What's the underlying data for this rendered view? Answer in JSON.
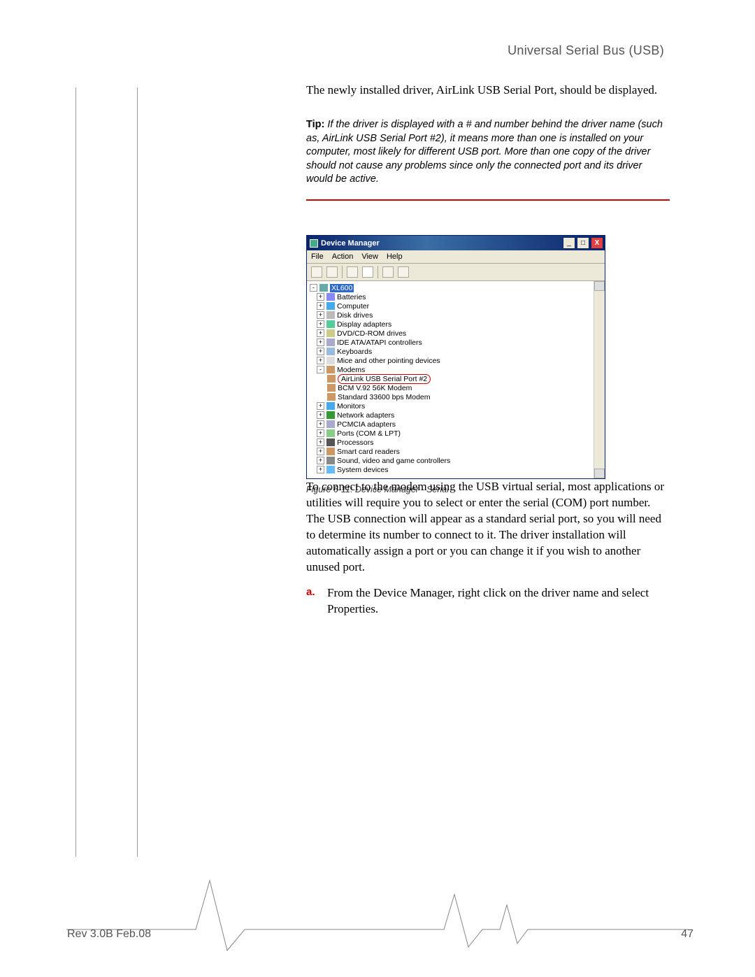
{
  "header": {
    "title": "Universal Serial Bus (USB)"
  },
  "body": {
    "p1": "The newly installed driver, AirLink USB Serial Port, should be displayed.",
    "tip_label": "Tip:",
    "tip_text": "If the driver is displayed with a # and number behind the driver name (such as, AirLink USB Serial Port #2), it means more than one is installed on your computer, most likely for different USB port. More than one copy of the driver should not cause any problems since only the connected port and its driver would be active.",
    "caption": "Figure 6-11: Device Manager - Serial",
    "p2": "To connect to the modem using the USB virtual serial, most applications or utilities will require you to select or enter the serial (COM) port number. The USB connection will appear as a standard serial port, so you will need to determine its number to connect to it. The driver installation will automatically assign a port or you can change it if you wish to another unused port.",
    "step_letter": "a.",
    "step_text": "From the Device Manager, right click on the driver name and select Properties."
  },
  "device_manager": {
    "title": "Device Manager",
    "menu": [
      "File",
      "Action",
      "View",
      "Help"
    ],
    "root": "XL600",
    "nodes": [
      {
        "label": "Batteries",
        "exp": "+",
        "icon": "i-bat"
      },
      {
        "label": "Computer",
        "exp": "+",
        "icon": "i-mon"
      },
      {
        "label": "Disk drives",
        "exp": "+",
        "icon": "i-disk"
      },
      {
        "label": "Display adapters",
        "exp": "+",
        "icon": "i-disp"
      },
      {
        "label": "DVD/CD-ROM drives",
        "exp": "+",
        "icon": "i-dvd"
      },
      {
        "label": "IDE ATA/ATAPI controllers",
        "exp": "+",
        "icon": "i-ide"
      },
      {
        "label": "Keyboards",
        "exp": "+",
        "icon": "i-kb"
      },
      {
        "label": "Mice and other pointing devices",
        "exp": "+",
        "icon": "i-mouse"
      },
      {
        "label": "Modems",
        "exp": "-",
        "icon": "i-modem"
      },
      {
        "label": "Monitors",
        "exp": "+",
        "icon": "i-mon"
      },
      {
        "label": "Network adapters",
        "exp": "+",
        "icon": "i-net"
      },
      {
        "label": "PCMCIA adapters",
        "exp": "+",
        "icon": "i-pcm"
      },
      {
        "label": "Ports (COM & LPT)",
        "exp": "+",
        "icon": "i-port"
      },
      {
        "label": "Processors",
        "exp": "+",
        "icon": "i-proc"
      },
      {
        "label": "Smart card readers",
        "exp": "+",
        "icon": "i-smart"
      },
      {
        "label": "Sound, video and game controllers",
        "exp": "+",
        "icon": "i-snd"
      },
      {
        "label": "System devices",
        "exp": "+",
        "icon": "i-sys"
      }
    ],
    "modem_children": [
      "AirLink USB Serial Port #2",
      "BCM V.92 56K Modem",
      "Standard 33600 bps Modem"
    ]
  },
  "footer": {
    "rev": "Rev 3.0B  Feb.08",
    "page": "47"
  }
}
